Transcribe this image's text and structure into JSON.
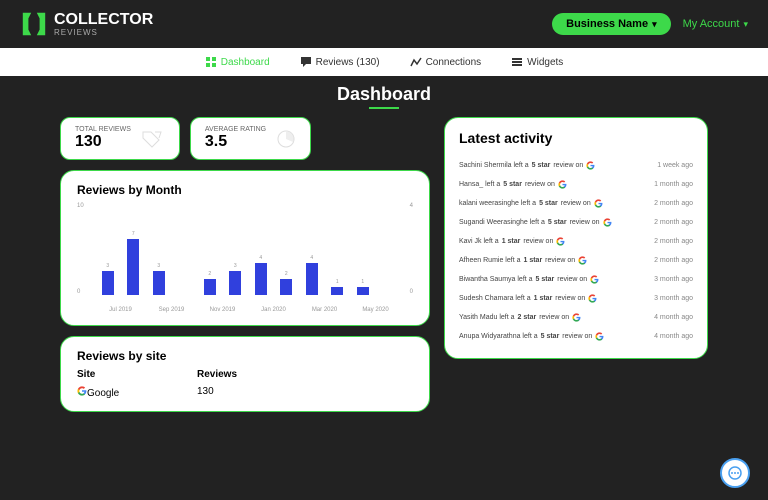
{
  "brand": {
    "name": "COLLECTOR",
    "sub": "REVIEWS"
  },
  "header": {
    "business_btn": "Business Name",
    "account": "My Account"
  },
  "nav": {
    "dashboard": "Dashboard",
    "reviews": "Reviews (130)",
    "connections": "Connections",
    "widgets": "Widgets"
  },
  "page_title": "Dashboard",
  "stats": {
    "total_label": "TOTAL  REVIEWS",
    "total_value": "130",
    "avg_label": "AVERAGE RATING",
    "avg_value": "3.5"
  },
  "by_month": {
    "title": "Reviews by Month"
  },
  "chart_data": {
    "type": "bar",
    "categories": [
      "Jul 2019",
      "Aug 2019",
      "Sep 2019",
      "Oct 2019",
      "Nov 2019",
      "Dec 2019",
      "Jan 2020",
      "Feb 2020",
      "Mar 2020",
      "Apr 2020",
      "May 2020",
      "Jun 2020"
    ],
    "values": [
      3,
      7,
      3,
      0,
      2,
      3,
      4,
      2,
      4,
      1,
      1,
      0
    ],
    "ylim": [
      0,
      10
    ],
    "y2lim": [
      0,
      4
    ],
    "x_ticks": [
      "Jul 2019",
      "Sep 2019",
      "Nov 2019",
      "Jan 2020",
      "Mar 2020",
      "May 2020"
    ],
    "ylabel": "",
    "xlabel": "",
    "title": "Reviews by Month"
  },
  "by_site": {
    "title": "Reviews by site",
    "hdr_site": "Site",
    "hdr_reviews": "Reviews",
    "row_site": "Google",
    "row_reviews": "130"
  },
  "activity": {
    "title": "Latest activity",
    "items": [
      {
        "name": "Sachini Shermila",
        "stars": "5",
        "time": "1 week ago"
      },
      {
        "name": "Hansa_",
        "stars": "5",
        "time": "1 month ago"
      },
      {
        "name": "kalani weerasinghe",
        "stars": "5",
        "time": "2 month ago"
      },
      {
        "name": "Sugandi Weerasinghe",
        "stars": "5",
        "time": "2 month ago"
      },
      {
        "name": "Kavi Jk",
        "stars": "1",
        "time": "2 month ago"
      },
      {
        "name": "Afheen Rumie",
        "stars": "1",
        "time": "2 month ago"
      },
      {
        "name": "Biwantha Saumya",
        "stars": "5",
        "time": "3 month ago"
      },
      {
        "name": "Sudesh Chamara",
        "stars": "1",
        "time": "3 month ago"
      },
      {
        "name": "Yasith Madu",
        "stars": "2",
        "time": "4 month ago"
      },
      {
        "name": "Anupa Widyarathna",
        "stars": "5",
        "time": "4 month ago"
      }
    ],
    "tpl_left": "left a",
    "tpl_star": "star",
    "tpl_review_on": "review on"
  }
}
